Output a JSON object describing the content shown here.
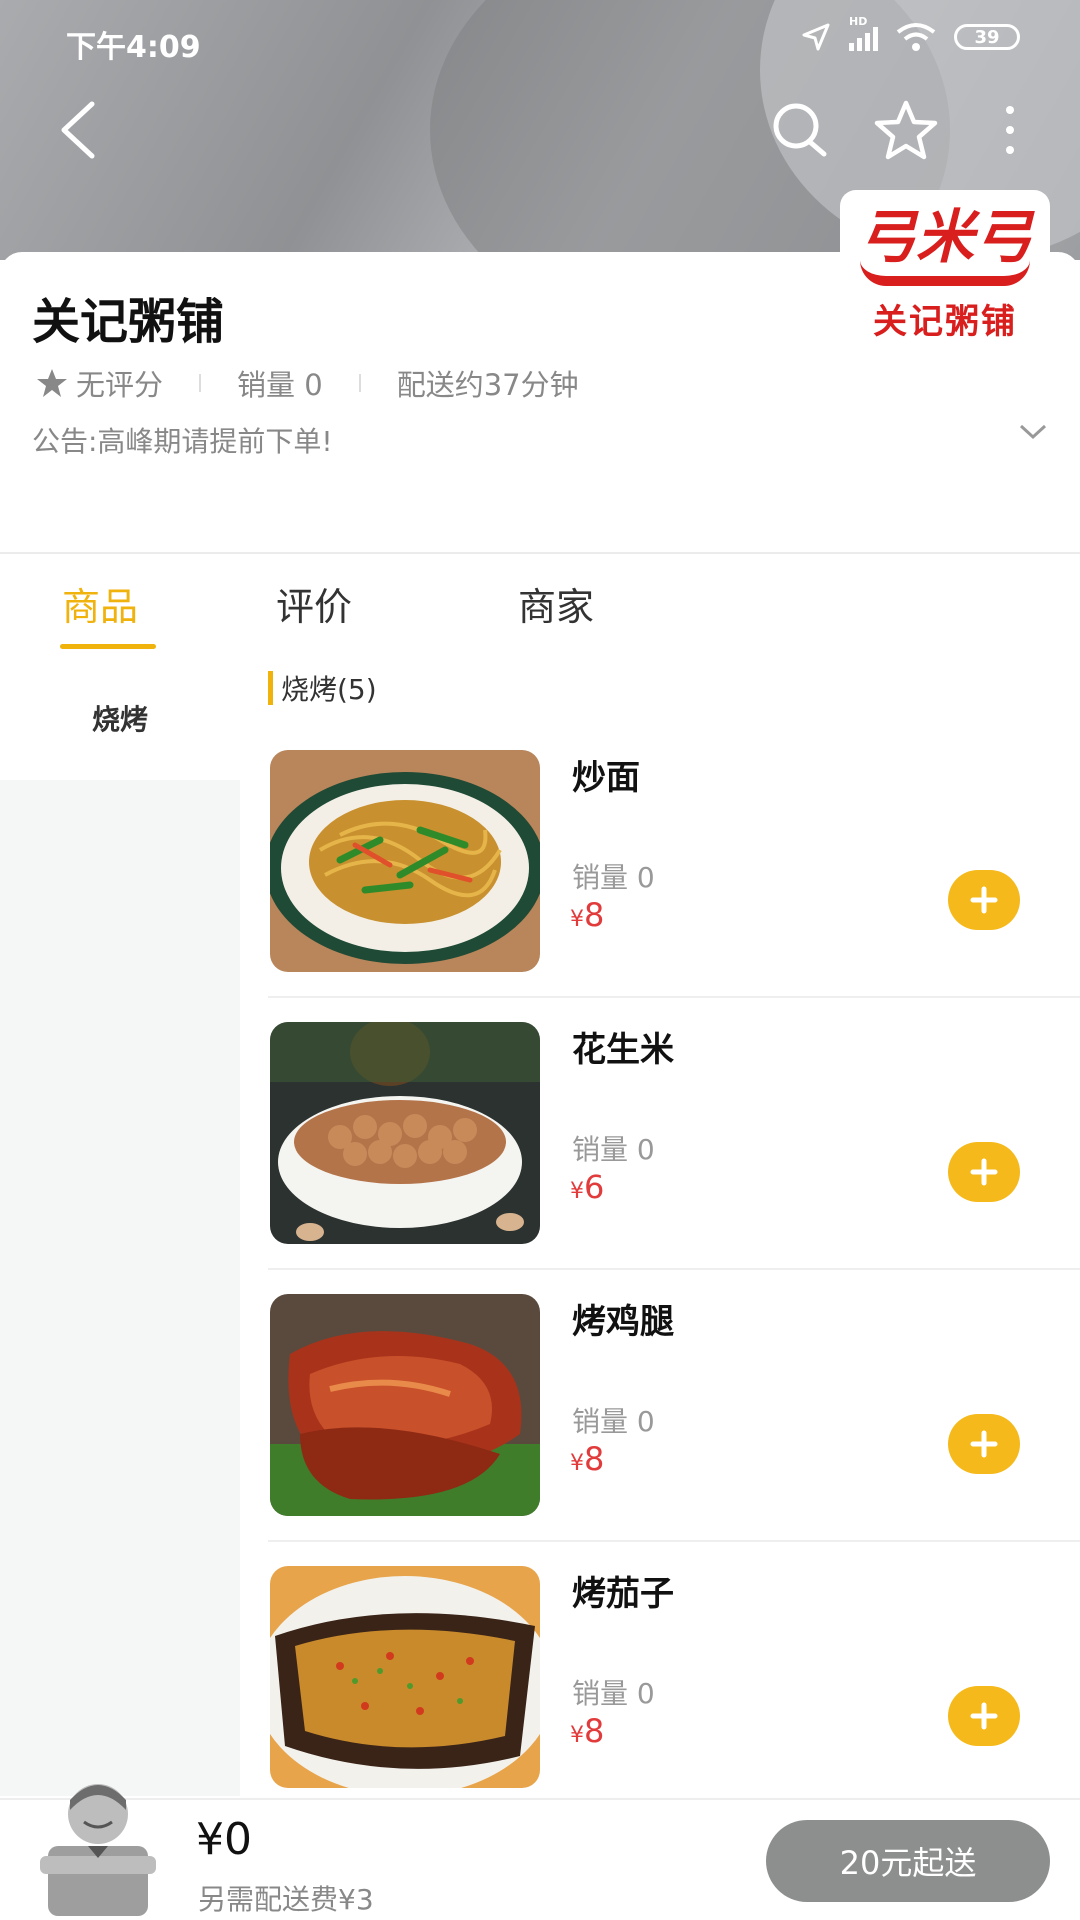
{
  "status_bar": {
    "time": "下午4:09",
    "network": "HD",
    "battery": "39"
  },
  "toolbar": {
    "back_icon": "back-icon",
    "search_icon": "search-icon",
    "favorite_icon": "star-icon",
    "more_icon": "more-vertical-icon"
  },
  "shop": {
    "name": "关记粥铺",
    "logo_lettering": "关记粥铺",
    "rating": "无评分",
    "sales": "销量 0",
    "delivery": "配送约37分钟",
    "notice": "公告:高峰期请提前下单!"
  },
  "tabs": [
    {
      "label": "商品",
      "active": true
    },
    {
      "label": "评价",
      "active": false
    },
    {
      "label": "商家",
      "active": false
    }
  ],
  "categories": [
    {
      "label": "烧烤",
      "active": true
    }
  ],
  "section": {
    "title": "烧烤(5)"
  },
  "products": [
    {
      "name": "炒面",
      "sales": "销量 0",
      "currency": "¥",
      "price": "8",
      "image": "fried-noodles"
    },
    {
      "name": "花生米",
      "sales": "销量 0",
      "currency": "¥",
      "price": "6",
      "image": "peanuts"
    },
    {
      "name": "烤鸡腿",
      "sales": "销量 0",
      "currency": "¥",
      "price": "8",
      "image": "roast-chicken-leg"
    },
    {
      "name": "烤茄子",
      "sales": "销量 0",
      "currency": "¥",
      "price": "8",
      "image": "roast-eggplant"
    }
  ],
  "cart": {
    "total": "¥0",
    "fee_note": "另需配送费¥3",
    "submit_label": "20元起送"
  },
  "colors": {
    "accent": "#f0b20c",
    "price": "#e23b3b",
    "submit_disabled": "#8d8e8e",
    "logo_red": "#d91e1e"
  }
}
